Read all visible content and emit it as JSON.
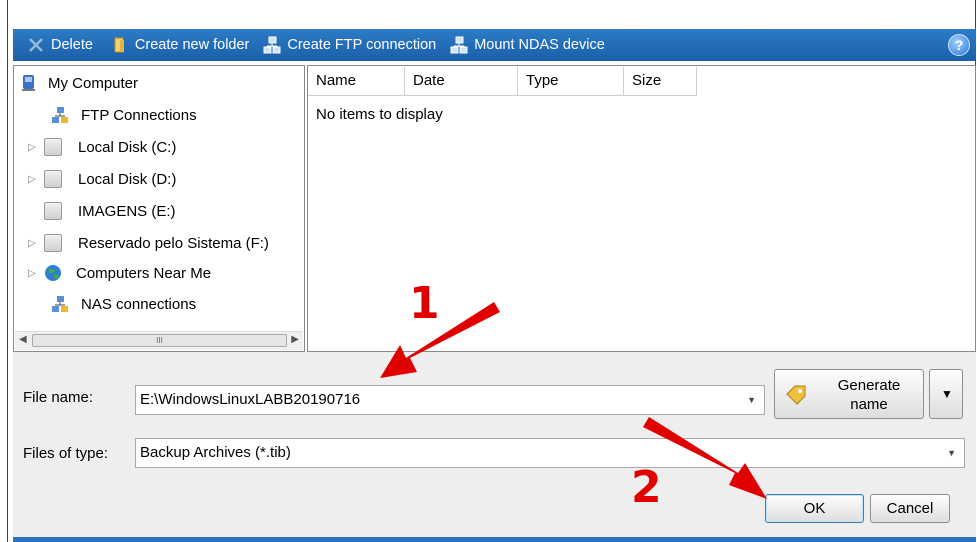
{
  "toolbar": {
    "delete_label": "Delete",
    "new_folder_label": "Create new folder",
    "ftp_label": "Create FTP connection",
    "ndas_label": "Mount NDAS device",
    "help_glyph": "?"
  },
  "tree": {
    "items": [
      {
        "label": "My Computer",
        "icon": "computer-icon"
      },
      {
        "label": "FTP Connections",
        "icon": "network-icon"
      },
      {
        "label": "Local Disk (C:)",
        "icon": "disk-icon"
      },
      {
        "label": "Local Disk (D:)",
        "icon": "disk-icon"
      },
      {
        "label": "IMAGENS (E:)",
        "icon": "disk-icon"
      },
      {
        "label": "Reservado pelo Sistema (F:)",
        "icon": "disk-icon"
      },
      {
        "label": "Computers Near Me",
        "icon": "globe-icon"
      },
      {
        "label": "NAS connections",
        "icon": "network-icon"
      }
    ],
    "scroll_thumb_text": "III"
  },
  "files": {
    "columns": [
      "Name",
      "Date",
      "Type",
      "Size"
    ],
    "empty_text": "No items to display"
  },
  "form": {
    "filename_label": "File name:",
    "filename_value": "E:\\WindowsLinuxLABB20190716",
    "filetype_label": "Files of type:",
    "filetype_value": "Backup Archives (*.tib)",
    "generate_line1": "Generate",
    "generate_line2": "name",
    "ok_label": "OK",
    "cancel_label": "Cancel"
  },
  "annotations": {
    "first": "1",
    "second": "2"
  },
  "colors": {
    "toolbar": "#1b5fa9",
    "annotation": "#e00000"
  }
}
